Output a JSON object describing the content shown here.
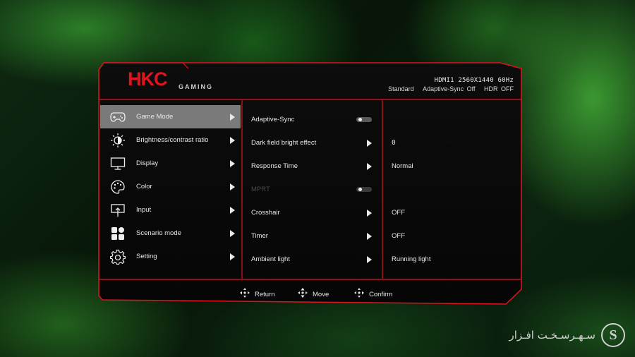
{
  "brand": {
    "logo": "HKC",
    "sub": "GAMING",
    "accent_color": "#e0141d"
  },
  "status": {
    "signal": "HDMI1 2560X1440 60Hz",
    "mode": "Standard",
    "adaptive_sync": "Adaptive-Sync Off",
    "hdr": "HDR OFF"
  },
  "menu": {
    "items": [
      {
        "label": "Game Mode",
        "icon": "gamepad-icon",
        "active": true
      },
      {
        "label": "Brightness/contrast ratio",
        "icon": "brightness-icon"
      },
      {
        "label": "Display",
        "icon": "monitor-icon"
      },
      {
        "label": "Color",
        "icon": "palette-icon"
      },
      {
        "label": "Input",
        "icon": "input-icon"
      },
      {
        "label": "Scenario mode",
        "icon": "scenario-icon"
      },
      {
        "label": "Setting",
        "icon": "gear-icon"
      }
    ]
  },
  "submenu": {
    "items": [
      {
        "label": "Adaptive-Sync",
        "control": "toggle",
        "state": "off"
      },
      {
        "label": "Dark field bright effect",
        "control": "arrow",
        "value": "0"
      },
      {
        "label": "Response Time",
        "control": "arrow",
        "value": "Normal"
      },
      {
        "label": "MPRT",
        "control": "toggle",
        "state": "off",
        "disabled": true
      },
      {
        "label": "Crosshair",
        "control": "arrow",
        "value": "OFF"
      },
      {
        "label": "Timer",
        "control": "arrow",
        "value": "OFF"
      },
      {
        "label": "Ambient light",
        "control": "arrow",
        "value": "Running light"
      }
    ]
  },
  "footer": {
    "return_label": "Return",
    "move_label": "Move",
    "confirm_label": "Confirm"
  },
  "watermark": {
    "text": "سـهـرسـخـت افـزار",
    "logo": "S"
  }
}
